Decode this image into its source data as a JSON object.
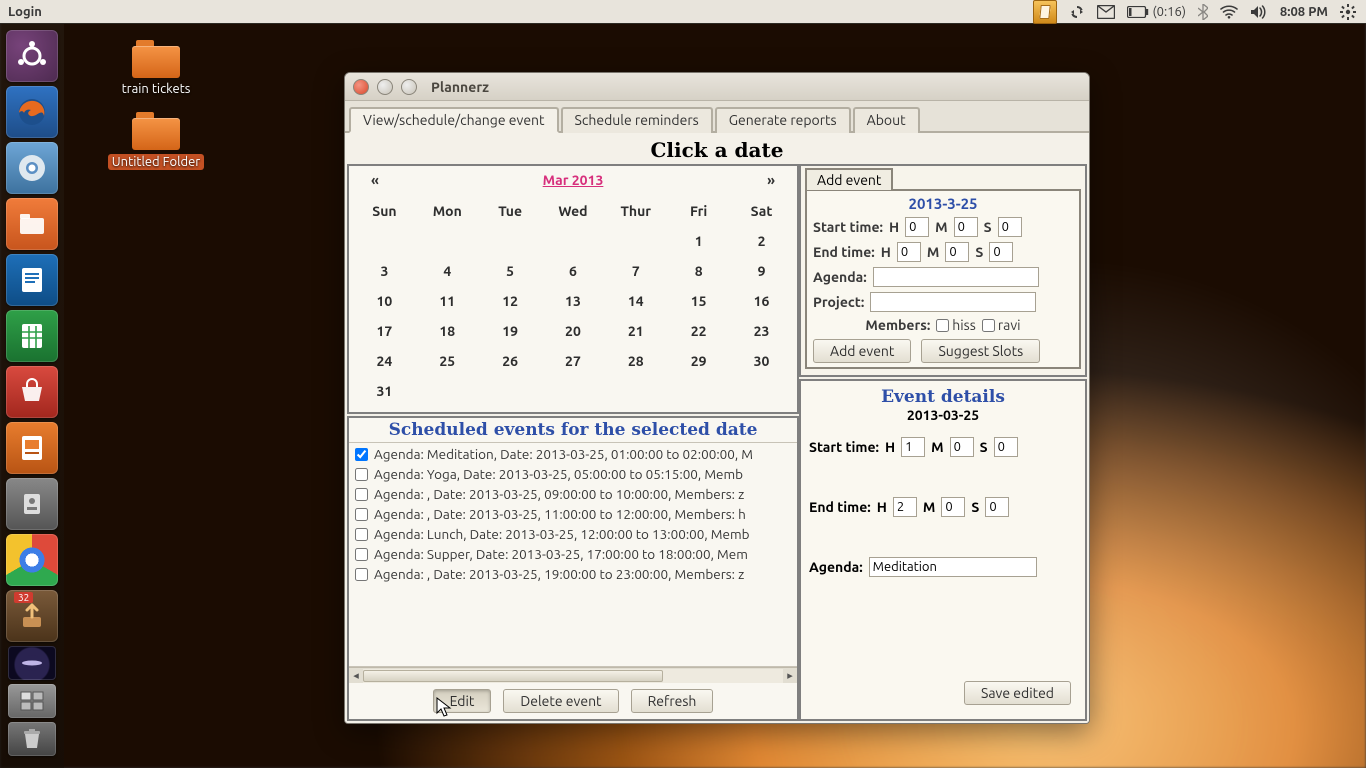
{
  "topbar": {
    "title": "Login",
    "battery": "(0:16)",
    "clock": "8:08 PM"
  },
  "launcher": {
    "update_badge": "32"
  },
  "desktop": {
    "folder1": "train tickets",
    "folder2": "Untitled Folder"
  },
  "window": {
    "title": "Plannerz",
    "tabs": {
      "view": "View/schedule/change event",
      "reminders": "Schedule reminders",
      "reports": "Generate reports",
      "about": "About"
    },
    "heading": "Click a date",
    "calendar": {
      "prev": "«",
      "next": "»",
      "month": "Mar 2013",
      "days": [
        "Sun",
        "Mon",
        "Tue",
        "Wed",
        "Thur",
        "Fri",
        "Sat"
      ],
      "weeks": [
        [
          "",
          "",
          "",
          "",
          "",
          "1",
          "2"
        ],
        [
          "3",
          "4",
          "5",
          "6",
          "7",
          "8",
          "9"
        ],
        [
          "10",
          "11",
          "12",
          "13",
          "14",
          "15",
          "16"
        ],
        [
          "17",
          "18",
          "19",
          "20",
          "21",
          "22",
          "23"
        ],
        [
          "24",
          "25",
          "26",
          "27",
          "28",
          "29",
          "30"
        ],
        [
          "31",
          "",
          "",
          "",
          "",
          "",
          ""
        ]
      ]
    },
    "events_heading": "Scheduled events for the selected date",
    "events": [
      {
        "checked": true,
        "text": "Agenda: Meditation, Date: 2013-03-25, 01:00:00 to 02:00:00, M"
      },
      {
        "checked": false,
        "text": "Agenda: Yoga, Date: 2013-03-25, 05:00:00 to 05:15:00, Memb"
      },
      {
        "checked": false,
        "text": "Agenda: , Date: 2013-03-25, 09:00:00 to 10:00:00, Members: z"
      },
      {
        "checked": false,
        "text": "Agenda: , Date: 2013-03-25, 11:00:00 to 12:00:00, Members: h"
      },
      {
        "checked": false,
        "text": "Agenda: Lunch, Date: 2013-03-25, 12:00:00 to 13:00:00, Memb"
      },
      {
        "checked": false,
        "text": "Agenda: Supper, Date: 2013-03-25, 17:00:00 to 18:00:00, Mem"
      },
      {
        "checked": false,
        "text": "Agenda: , Date: 2013-03-25, 19:00:00 to 23:00:00, Members: z"
      }
    ],
    "buttons": {
      "edit": "Edit",
      "delete": "Delete event",
      "refresh": "Refresh"
    },
    "add": {
      "tab": "Add event",
      "date": "2013-3-25",
      "labels": {
        "start": "Start time:",
        "end": "End time:",
        "H": "H",
        "M": "M",
        "S": "S",
        "agenda": "Agenda:",
        "project": "Project:",
        "members": "Members:"
      },
      "start": {
        "h": "0",
        "m": "0",
        "s": "0"
      },
      "end": {
        "h": "0",
        "m": "0",
        "s": "0"
      },
      "agenda": "",
      "project": "",
      "member1": "hiss",
      "member2": "ravi",
      "btn_add": "Add event",
      "btn_suggest": "Suggest Slots"
    },
    "details": {
      "heading": "Event details",
      "date": "2013-03-25",
      "labels": {
        "start": "Start time:",
        "end": "End time:",
        "H": "H",
        "M": "M",
        "S": "S",
        "agenda": "Agenda:"
      },
      "start": {
        "h": "1",
        "m": "0",
        "s": "0"
      },
      "end": {
        "h": "2",
        "m": "0",
        "s": "0"
      },
      "agenda": "Meditation",
      "save": "Save edited"
    }
  }
}
